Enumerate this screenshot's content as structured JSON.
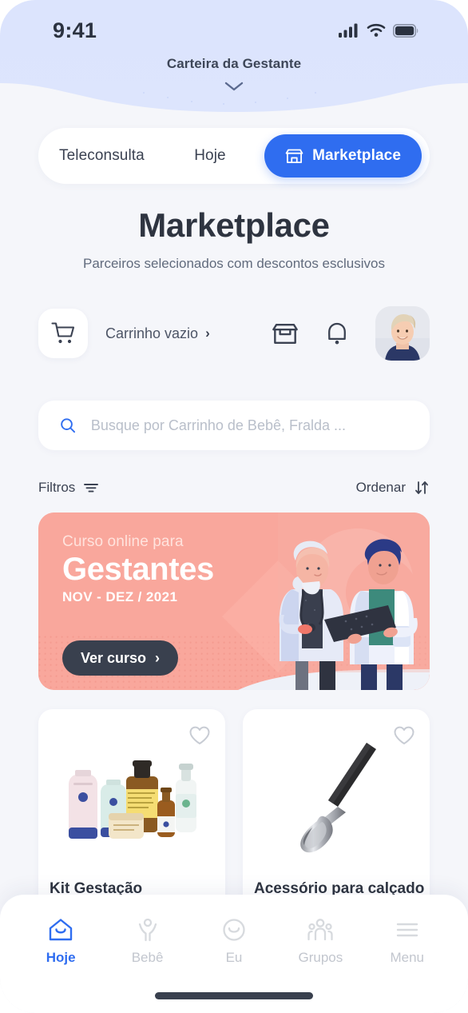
{
  "status_bar": {
    "time": "9:41",
    "signal_icon": "cellular-signal-icon",
    "wifi_icon": "wifi-icon",
    "battery_icon": "battery-icon"
  },
  "header": {
    "title": "Carteira da Gestante",
    "expand_icon": "chevron-down-icon",
    "background_color": "#dbe3fd"
  },
  "tabs": [
    {
      "label": "Teleconsulta",
      "active": false,
      "icon": null
    },
    {
      "label": "Hoje",
      "active": false,
      "icon": null
    },
    {
      "label": "Marketplace",
      "active": true,
      "icon": "store-icon"
    }
  ],
  "page": {
    "title": "Marketplace",
    "subtitle": "Parceiros selecionados com descontos esclusivos",
    "accent_color": "#2f6df0",
    "background_color": "#f5f6fa"
  },
  "action_row": {
    "cart_icon": "shopping-cart-icon",
    "cart_label": "Carrinho vazio",
    "cart_chevron": "›",
    "store_icon": "store-icon",
    "bell_icon": "notification-bell-icon",
    "avatar": "user-avatar"
  },
  "search": {
    "icon": "search-icon",
    "placeholder": "Busque por Carrinho de Bebê, Fralda ...",
    "value": ""
  },
  "filter_row": {
    "filters_label": "Filtros",
    "filters_icon": "filter-icon",
    "sort_label": "Ordenar",
    "sort_icon": "sort-arrows-icon"
  },
  "banner": {
    "kicker": "Curso online para",
    "title": "Gestantes",
    "dates": "NOV - DEZ / 2021",
    "button_label": "Ver curso",
    "button_chevron": "›",
    "background_color": "#f9a79c",
    "button_color": "#39404e",
    "illustration": "two-doctors-illustration"
  },
  "products": [
    {
      "name": "Kit Gestação",
      "favorite_icon": "heart-outline-icon",
      "image": "pregnancy-cosmetics-kit"
    },
    {
      "name": "Acessório para calçado",
      "favorite_icon": "heart-outline-icon",
      "image": "shoe-horn"
    }
  ],
  "bottom_nav": [
    {
      "label": "Hoje",
      "icon": "home-icon",
      "active": true
    },
    {
      "label": "Bebê",
      "icon": "baby-icon",
      "active": false
    },
    {
      "label": "Eu",
      "icon": "smiley-face-icon",
      "active": false
    },
    {
      "label": "Grupos",
      "icon": "people-group-icon",
      "active": false
    },
    {
      "label": "Menu",
      "icon": "hamburger-menu-icon",
      "active": false
    }
  ],
  "home_indicator": "home-indicator-bar"
}
